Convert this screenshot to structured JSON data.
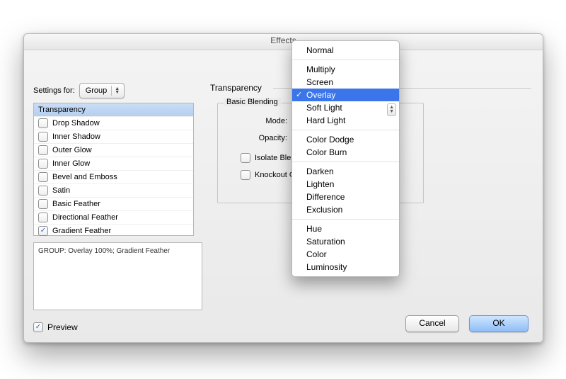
{
  "dialog": {
    "title": "Effects",
    "settingsForLabel": "Settings for:",
    "settingsForValue": "Group",
    "sectionLabel": "Transparency",
    "fieldsetLegend": "Basic Blending",
    "modeLabel": "Mode:",
    "opacityLabel": "Opacity:",
    "isolateLabel": "Isolate Blending",
    "knockoutLabel": "Knockout Group",
    "previewLabel": "Preview",
    "cancel": "Cancel",
    "ok": "OK",
    "summary": "GROUP: Overlay 100%; Gradient Feather"
  },
  "effectsList": [
    {
      "label": "Transparency"
    },
    {
      "label": "Drop Shadow"
    },
    {
      "label": "Inner Shadow"
    },
    {
      "label": "Outer Glow"
    },
    {
      "label": "Inner Glow"
    },
    {
      "label": "Bevel and Emboss"
    },
    {
      "label": "Satin"
    },
    {
      "label": "Basic Feather"
    },
    {
      "label": "Directional Feather"
    },
    {
      "label": "Gradient Feather"
    }
  ],
  "menu": {
    "selected": "Overlay",
    "groups": [
      [
        "Normal"
      ],
      [
        "Multiply",
        "Screen",
        "Overlay",
        "Soft Light",
        "Hard Light"
      ],
      [
        "Color Dodge",
        "Color Burn"
      ],
      [
        "Darken",
        "Lighten",
        "Difference",
        "Exclusion"
      ],
      [
        "Hue",
        "Saturation",
        "Color",
        "Luminosity"
      ]
    ]
  }
}
